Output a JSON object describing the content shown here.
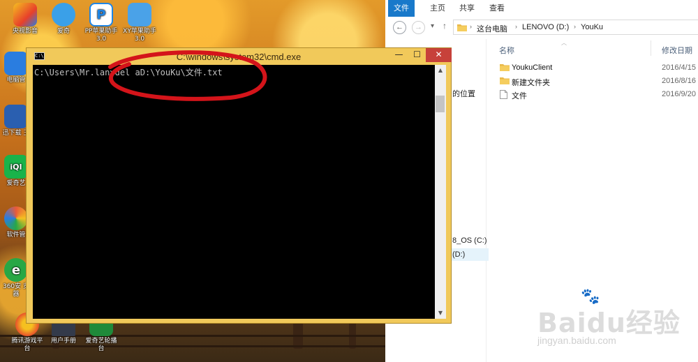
{
  "desktop": {
    "icons": [
      {
        "label": "央视影音",
        "glyph": "",
        "color": "#e8402a"
      },
      {
        "label": "爱奇",
        "glyph": "",
        "color": "#3aa0e8"
      },
      {
        "label": "PP苹果助手 3.0",
        "glyph": "P",
        "color": "#1f86e6"
      },
      {
        "label": "XY苹果助手 3.0",
        "glyph": "",
        "color": "#4aa2e8"
      },
      {
        "label": "电脑管",
        "glyph": "",
        "color": "#2a7de0"
      },
      {
        "label": "迅下载 王",
        "glyph": "",
        "color": "#2a5fb0"
      },
      {
        "label": "爱奇艺",
        "glyph": "iQI",
        "color": "#19b34a"
      },
      {
        "label": "软件管",
        "glyph": "",
        "color": "#e85a3a"
      },
      {
        "label": "360安 览器",
        "glyph": "e",
        "color": "#28a745"
      },
      {
        "label": "腾讯游戏平 台",
        "glyph": "",
        "color": "#e8522a"
      },
      {
        "label": "用户手册",
        "glyph": "",
        "color": "#333a4a"
      },
      {
        "label": "爱奇艺轮播 台",
        "glyph": "",
        "color": "#1f8a3a"
      }
    ]
  },
  "cmd": {
    "title": "C:\\windows\\system32\\cmd.exe",
    "sysicon_text": "C:\\",
    "min_glyph": "—",
    "max_glyph": "☐",
    "close_glyph": "✕",
    "lines": [
      "C:\\Users\\Mr.lan>del aD:\\YouKu\\文件.txt"
    ],
    "scroll_up": "▲",
    "scroll_down": "▼"
  },
  "explorer": {
    "ribbon_tabs": [
      "文件",
      "主页",
      "共享",
      "查看"
    ],
    "nav": {
      "back": "←",
      "forward": "→",
      "recent": "▾",
      "up": "↑"
    },
    "breadcrumbs": [
      "这台电脑",
      "LENOVO (D:)",
      "YouKu"
    ],
    "navpane": {
      "items": [
        "的位置",
        "8_OS (C:)",
        "(D:)"
      ]
    },
    "columns": {
      "name": "名称",
      "date": "修改日期"
    },
    "files": [
      {
        "name": "YoukuClient",
        "date": "2016/4/15",
        "kind": "folder"
      },
      {
        "name": "新建文件夹",
        "date": "2016/8/16",
        "kind": "folder"
      },
      {
        "name": "文件",
        "date": "2016/9/20",
        "kind": "file"
      }
    ]
  },
  "watermark": {
    "brand": "Baidu经验",
    "url": "jingyan.baidu.com"
  },
  "colors": {
    "accent": "#1979ca",
    "annotation": "#d4141a",
    "cmd_frame": "#f1c95a",
    "close": "#c7413a"
  }
}
